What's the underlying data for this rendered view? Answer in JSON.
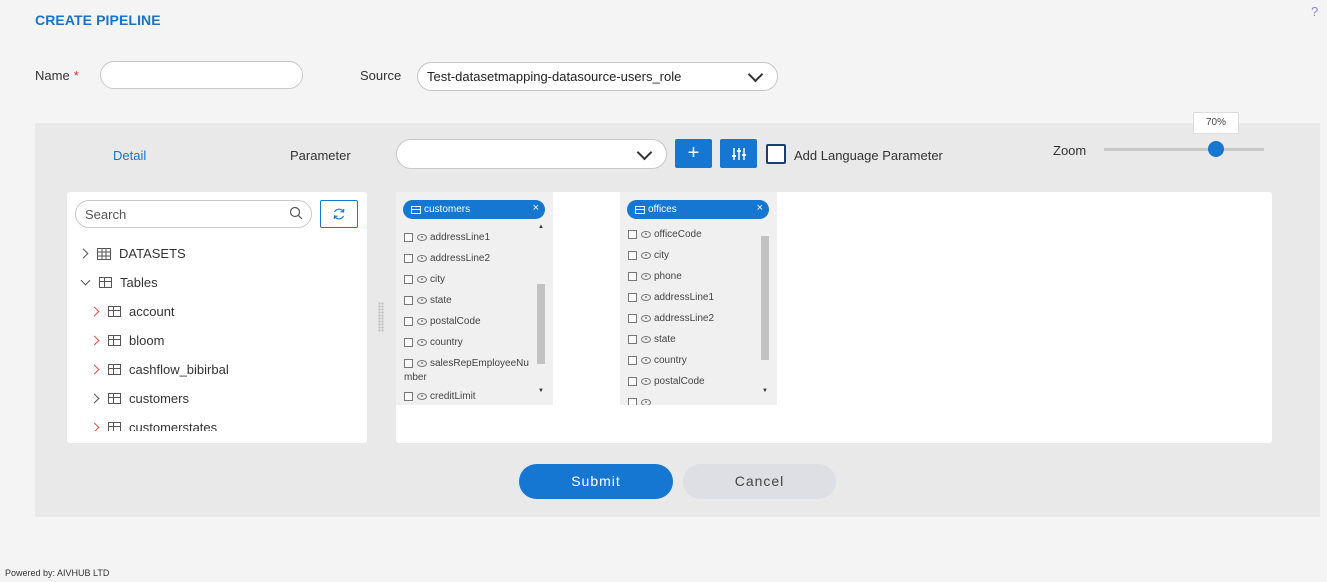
{
  "header": {
    "title": "CREATE PIPELINE",
    "help": "?"
  },
  "form": {
    "name_label": "Name",
    "required_mark": "*",
    "name_value": "",
    "source_label": "Source",
    "source_value": "Test-datasetmapping-datasource-users_role"
  },
  "toolbar": {
    "detail_tab": "Detail",
    "parameter_label": "Parameter",
    "parameter_value": "",
    "add_button": "+",
    "lang_param_label": "Add Language Parameter",
    "zoom_label": "Zoom",
    "zoom_value": "70%",
    "zoom_level": 0.7
  },
  "tree": {
    "search_placeholder": "Search",
    "items": [
      {
        "label": "DATASETS",
        "level": 0
      },
      {
        "label": "Tables",
        "level": 0
      },
      {
        "label": "account",
        "level": 1
      },
      {
        "label": "bloom",
        "level": 1
      },
      {
        "label": "cashflow_bibirbal",
        "level": 1
      },
      {
        "label": "customers",
        "level": 1
      },
      {
        "label": "customerstates",
        "level": 1
      }
    ]
  },
  "canvas": {
    "nodes": [
      {
        "title": "customers",
        "close": "×",
        "fields": [
          "addressLine1",
          "addressLine2",
          "city",
          "state",
          "postalCode",
          "country",
          "salesRepEmployeeNu",
          "mber",
          "creditLimit"
        ]
      },
      {
        "title": "offices",
        "close": "×",
        "fields": [
          "officeCode",
          "city",
          "phone",
          "addressLine1",
          "addressLine2",
          "state",
          "country",
          "postalCode"
        ]
      }
    ]
  },
  "actions": {
    "submit": "Submit",
    "cancel": "Cancel"
  },
  "footer": {
    "text": "Powered by: AIVHUB LTD"
  },
  "colors": {
    "accent": "#1677d2",
    "required": "#dd3333",
    "panel": "#e9e9e9"
  }
}
